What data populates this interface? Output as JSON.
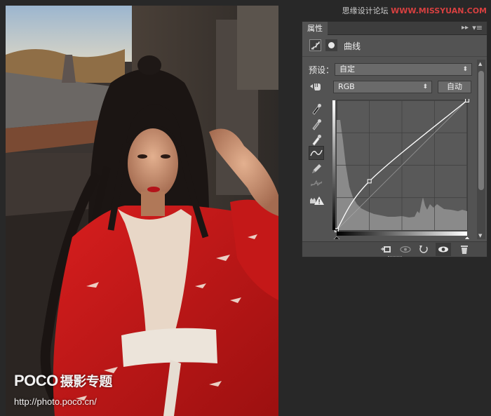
{
  "panel": {
    "tab_label": "属性",
    "collapse_icon": "▸▸",
    "menu_icon": "▾≡",
    "title": "曲线",
    "preset_label": "预设：",
    "preset_value": "自定",
    "channel_value": "RGB",
    "auto_label": "自动",
    "curve_points": [
      [
        0,
        0
      ],
      [
        64,
        96
      ],
      [
        255,
        255
      ]
    ],
    "icons": {
      "adjustment": "curves-adjustment-icon",
      "mask": "layer-mask-icon",
      "target": "targeted-adjustment-hand-icon",
      "tools": [
        "eyedropper-black-icon",
        "eyedropper-gray-icon",
        "eyedropper-white-icon",
        "curve-point-icon",
        "pencil-icon",
        "smooth-icon",
        "clipping-warning-icon"
      ],
      "footer": [
        "clip-to-layer-icon",
        "view-previous-icon",
        "reset-icon",
        "visibility-eye-icon",
        "trash-icon"
      ]
    }
  },
  "watermark": {
    "site_prefix": "思缘设计论坛",
    "site_domain": "WWW.MISSYUAN.COM",
    "poco": "POCO",
    "poco_suffix": "摄影专题",
    "poco_url": "http://photo.poco.cn/"
  },
  "colors": {
    "panel_bg": "#535353",
    "histogram": "#8a8a8a",
    "curve": "#ffffff",
    "workspace": "#282828"
  }
}
